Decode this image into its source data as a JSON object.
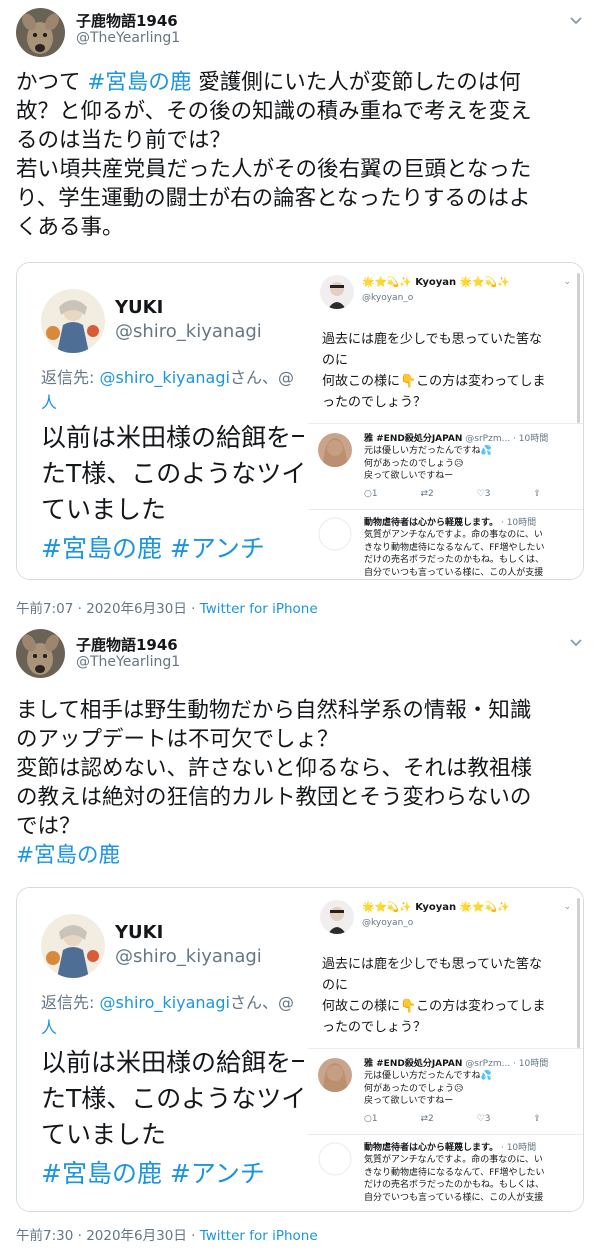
{
  "tweets": [
    {
      "author": {
        "name": "子鹿物語1946",
        "handle": "@TheYearling1"
      },
      "text_lines": [
        "かつて #宮島の鹿 愛護側にいた人が変節したのは何",
        "故？と仰るが、その後の知識の積み重ねで考えを変え",
        "るのは当たり前では？",
        "若い頃共産党員だった人がその後右翼の巨頭となった",
        "り、学生運動の闘士が右の論客となったりするのはよ",
        "くある事。"
      ],
      "hashtag_inline": "#宮島の鹿",
      "text_line1_before": "かつて ",
      "text_line1_after": " 愛護側にいた人が変節したのは何",
      "timestamp": "午前7:07 · 2020年6月30日",
      "source": "Twitter for iPhone"
    },
    {
      "author": {
        "name": "子鹿物語1946",
        "handle": "@TheYearling1"
      },
      "text_lines": [
        "まして相手は野生動物だから自然科学系の情報・知識",
        "のアップデートは不可欠でしょ？",
        "変節は認めない、許さないと仰るなら、それは教祖様",
        "の教えは絶対の狂信的カルト教団とそう変わらないの",
        "では？"
      ],
      "hashtag_line": "#宮島の鹿",
      "timestamp": "午前7:30 · 2020年6月30日",
      "source": "Twitter for iPhone"
    }
  ],
  "embedded": {
    "left": {
      "name": "YUKI",
      "handle": "@shiro_kiyanagi",
      "reply_prefix": "返信先: ",
      "reply_mention": "@shiro_kiyanagi",
      "reply_suffix": "さん、@",
      "reply_line2": "人",
      "body_lines": [
        "以前は米田様の給餌を一",
        "たT様、このようなツイ",
        "ていました"
      ],
      "tags": "#宮島の鹿 #アンチ"
    },
    "right": {
      "name": "🌟⭐💫✨ Kyoyan 🌟⭐💫✨",
      "handle": "@kyoyan_o",
      "body_lines": [
        "過去には鹿を少しでも思っていた筈な",
        "のに",
        "何故この様に👇この方は変わってしま",
        "ったのでしょう？"
      ],
      "reply1": {
        "name": "雅 #END殺処分JAPAN",
        "handle": "@srPzm...",
        "time": "· 10時間",
        "lines": [
          "元は優しい方だったんですね💦",
          "何があったのでしょう😥",
          "戻って欲しいですねー"
        ],
        "actions": [
          "1",
          "2",
          "3",
          ""
        ]
      },
      "reply2": {
        "name": "動物虐待者は心から軽蔑します。",
        "time": "· 10時間",
        "lines": [
          "気質がアンチなんですよ。命の事なのに、い",
          "きなり動物虐待になるなんて、FF増やしたい",
          "だけの売名ボラだったのかもね。もしくは、",
          "自分でいつも言っている様に、この人が支援"
        ]
      }
    }
  }
}
